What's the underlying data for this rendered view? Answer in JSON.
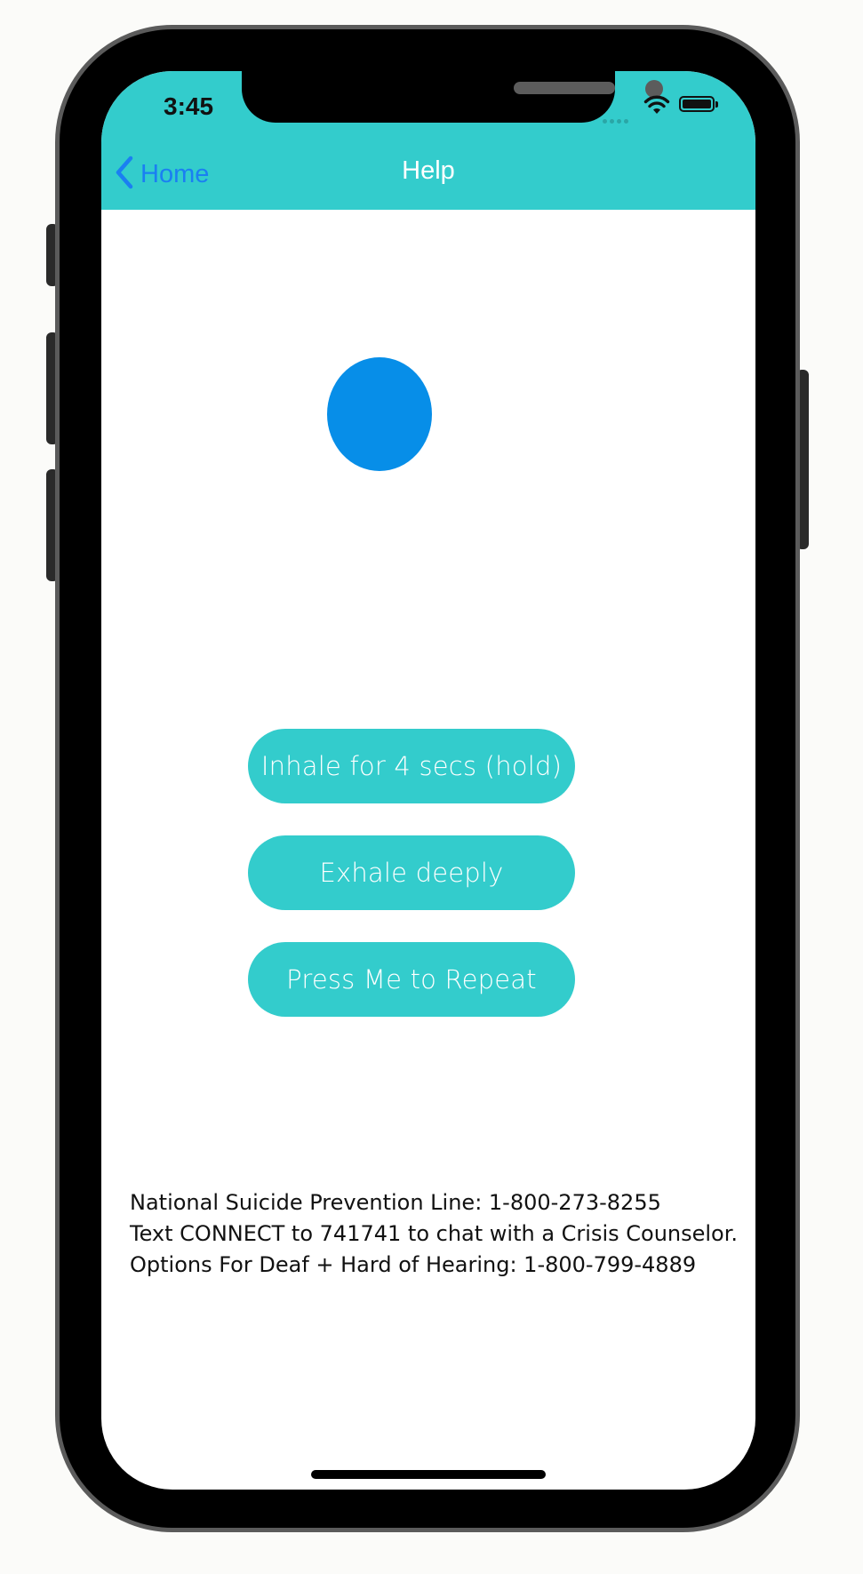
{
  "status_bar": {
    "time": "3:45"
  },
  "nav": {
    "back_label": "Home",
    "title": "Help"
  },
  "breathing": {
    "buttons": [
      {
        "label": "Inhale for 4 secs (hold)"
      },
      {
        "label": "Exhale deeply"
      },
      {
        "label": "Press Me to Repeat"
      }
    ]
  },
  "helplines": [
    "National Suicide Prevention Line: 1-800-273-8255",
    "Text CONNECT to 741741 to chat with a Crisis Counselor.",
    "Options For Deaf + Hard of Hearing: 1-800-799-4889"
  ],
  "colors": {
    "accent": "#33cccc",
    "link": "#1a7ff2",
    "circle": "#078ee8"
  }
}
